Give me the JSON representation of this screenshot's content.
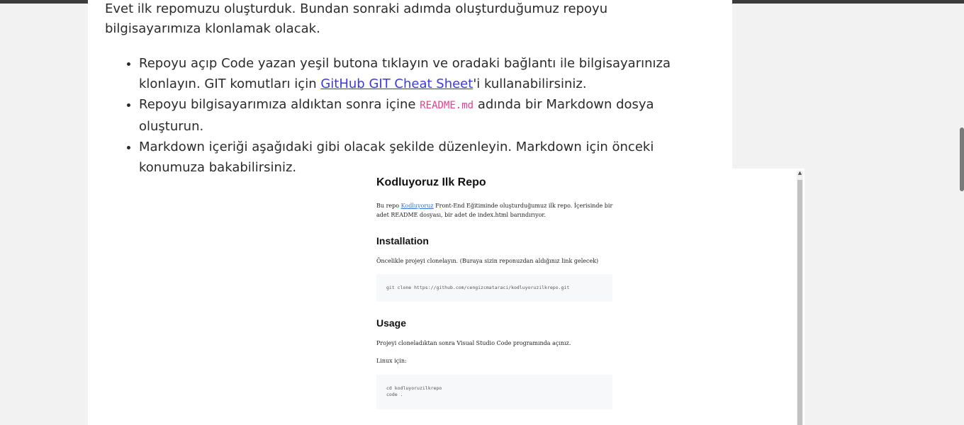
{
  "intro_paragraph": "Evet ilk repomuzu oluşturduk. Bundan sonraki adımda oluşturduğumuz repoyu bilgisayarımıza klonlamak olacak.",
  "steps": [
    {
      "before": "Repoyu açıp Code yazan yeşil butona tıklayın ve oradaki bağlantı ile bilgisayarınıza klonlayın. GIT komutları için ",
      "link": "GitHub GIT Cheat Sheet",
      "after": "'i kullanabilirsiniz."
    },
    {
      "before": "Repoyu bilgisayarımıza aldıktan sonra içine ",
      "code": "README.md",
      "after": " adında bir Markdown dosya oluşturun."
    },
    {
      "text": "Markdown içeriği aşağıdaki gibi olacak şekilde düzenleyin. Markdown için önceki konumuza bakabilirsiniz."
    }
  ],
  "readme": {
    "title": "Kodluyoruz Ilk Repo",
    "intro_before": "Bu repo ",
    "intro_link": "Kodluyoruz",
    "intro_after": " Front-End Eğitiminde oluşturduğumuz ilk repo. İçerisinde bir adet README dosyası, bir adet de index.html barındırıyor.",
    "installation_heading": "Installation",
    "installation_text": "Öncelikle projeyi clonelayın. (Buraya sizin reponuzdan aldığınız link gelecek)",
    "clone_command": "git clone https://github.com/cengizcmataraci/kodluyoruzilkrepo.git",
    "usage_heading": "Usage",
    "usage_text": "Projeyi cloneladıktan sonra Visual Studio Code programında açınız.",
    "linux_text": "Linux için:",
    "usage_commands": [
      "cd kodluyoruzilkrepo",
      "code ."
    ]
  }
}
